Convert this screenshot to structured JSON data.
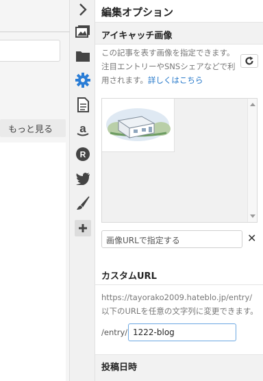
{
  "left": {
    "more_label": "もっと見る"
  },
  "rail": {
    "icons": [
      "collapse-chevron-icon",
      "image-icon",
      "folder-icon",
      "gear-icon",
      "document-icon",
      "amazon-icon",
      "r-circle-icon",
      "twitter-icon",
      "brush-icon",
      "plus-icon"
    ],
    "accent": "#2a7dd6"
  },
  "panel": {
    "title": "編集オプション",
    "eyecatch": {
      "title": "アイキャッチ画像",
      "desc": "この記事を表す画像を指定できます。注目エントリーやSNSシェアなどで利用されます。",
      "link": "詳しくはこちら",
      "url_placeholder": "画像URLで指定する"
    },
    "custom_url": {
      "title": "カスタムURL",
      "desc": "https://tayorako2009.hateblo.jp/entry/以下のURLを任意の文字列に変更できます。",
      "prefix": "/entry/",
      "value": "1222-blog"
    },
    "post_date": {
      "title": "投稿日時"
    }
  }
}
